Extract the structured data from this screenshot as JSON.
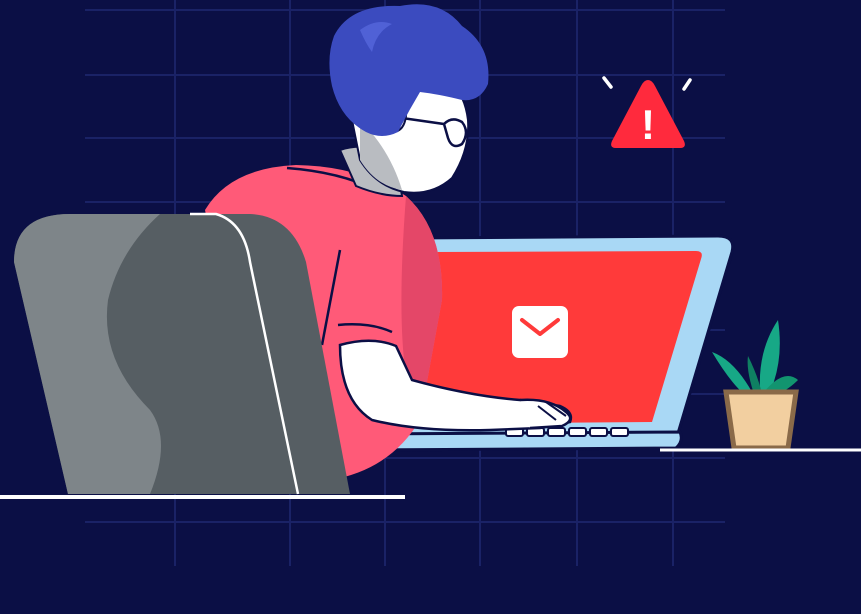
{
  "illustration": {
    "warning_symbol": "!",
    "colors": {
      "background": "#0b0f45",
      "grid": "#1a2266",
      "hair": "#3b4bbf",
      "skin": "#b9bcc1",
      "shirt": "#ff5a78",
      "chair": "#565e63",
      "screen": "#ff3a3a",
      "laptop_frame": "#a9d8f5",
      "alert": "#ff2a3d",
      "plant": "#17a886",
      "pot": "#f2cfa0"
    },
    "icons": [
      "warning-icon",
      "mail-icon",
      "plant-icon"
    ]
  }
}
